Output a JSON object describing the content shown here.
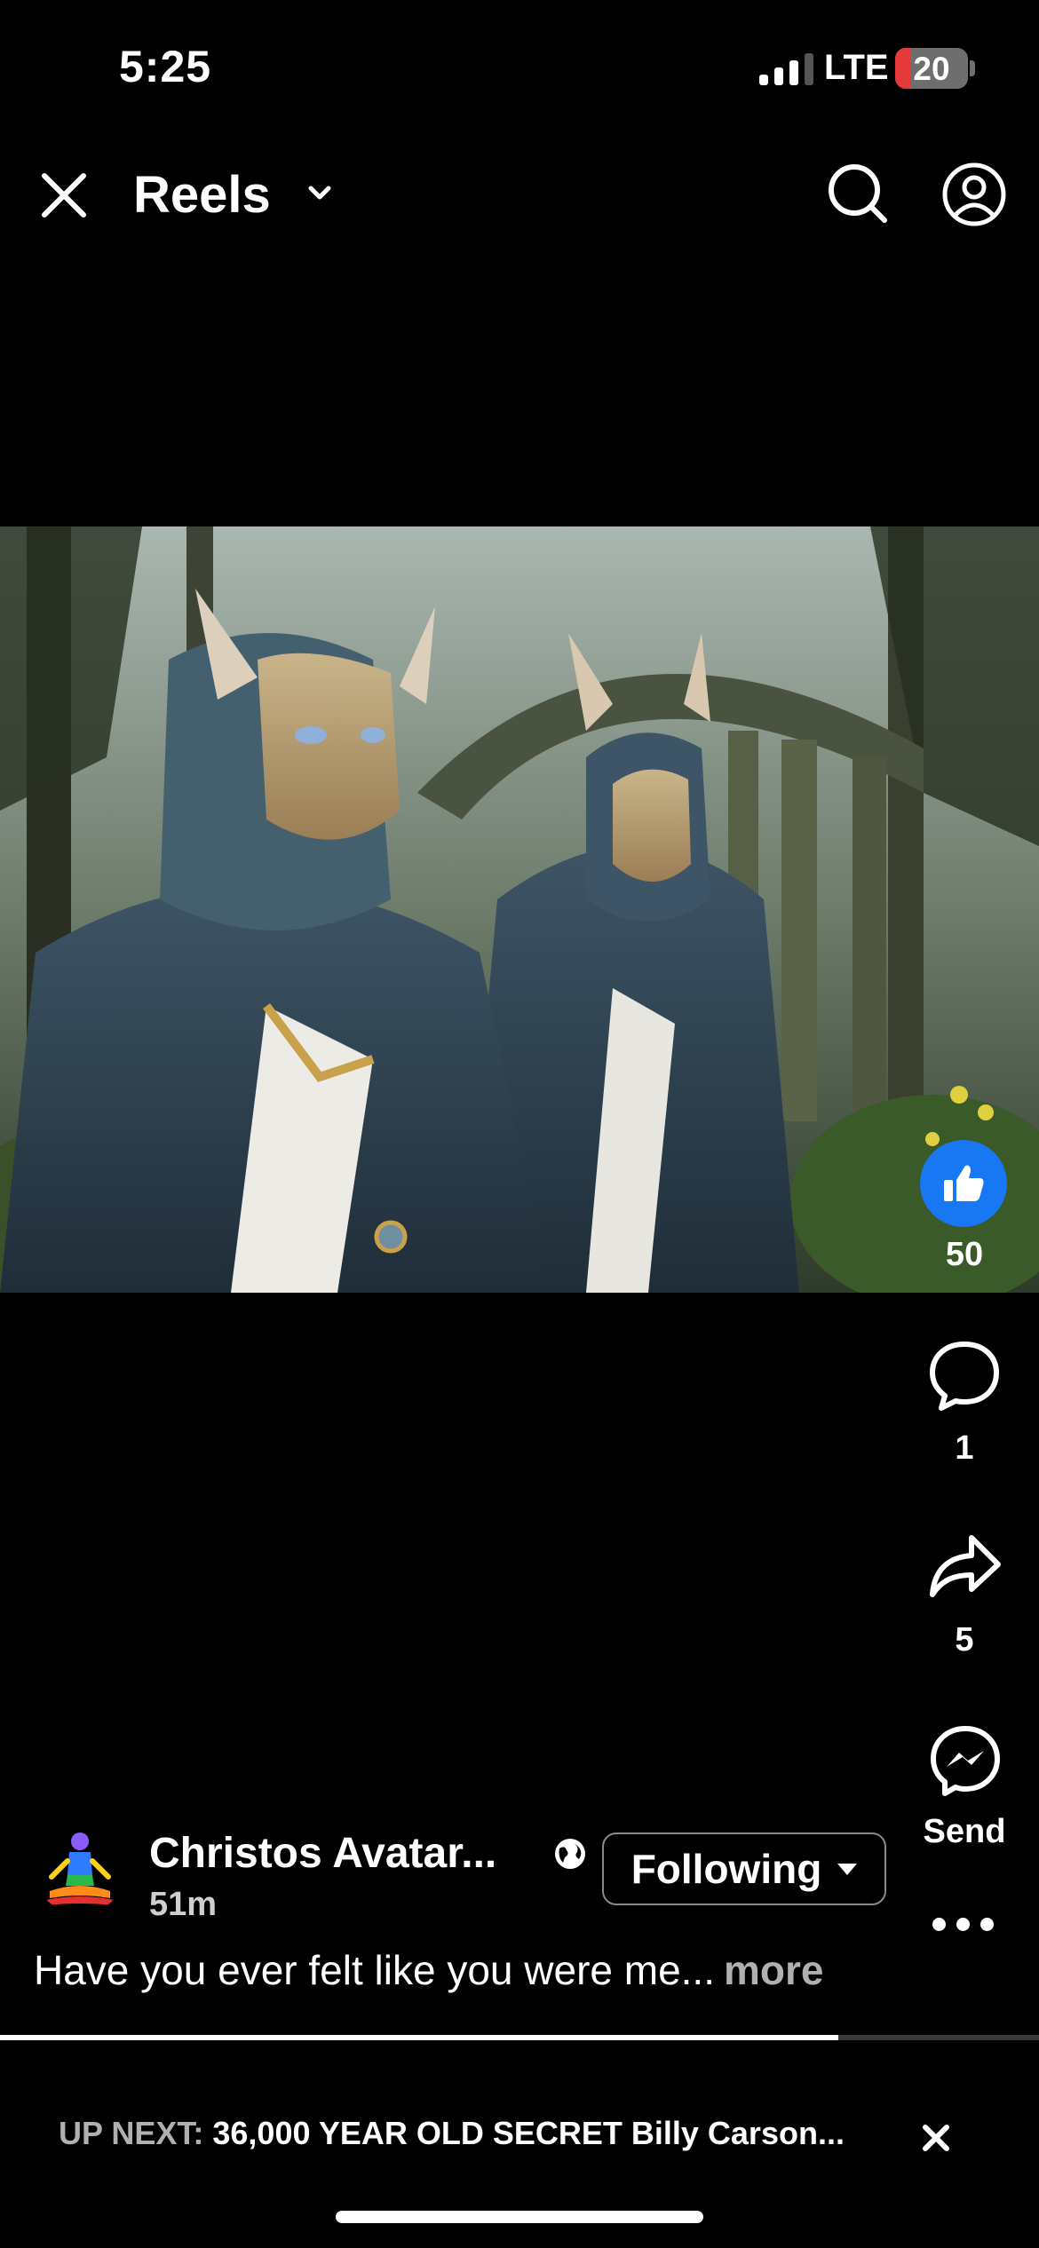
{
  "status_bar": {
    "time": "5:25",
    "network": "LTE",
    "battery": "20"
  },
  "header": {
    "title": "Reels"
  },
  "actions": {
    "like_count": "50",
    "comment_count": "1",
    "share_count": "5",
    "send_label": "Send"
  },
  "post": {
    "author": "Christos Avatar...",
    "time_ago": "51m",
    "follow_label": "Following",
    "caption": "Have you ever felt like you were me...",
    "caption_more": "more"
  },
  "playback": {
    "progress_fraction": 0.807
  },
  "up_next": {
    "label": "UP NEXT:",
    "title": "36,000 YEAR OLD SECRET Billy Carson..."
  },
  "colors": {
    "like_blue": "#1877f2",
    "background": "#000000"
  }
}
